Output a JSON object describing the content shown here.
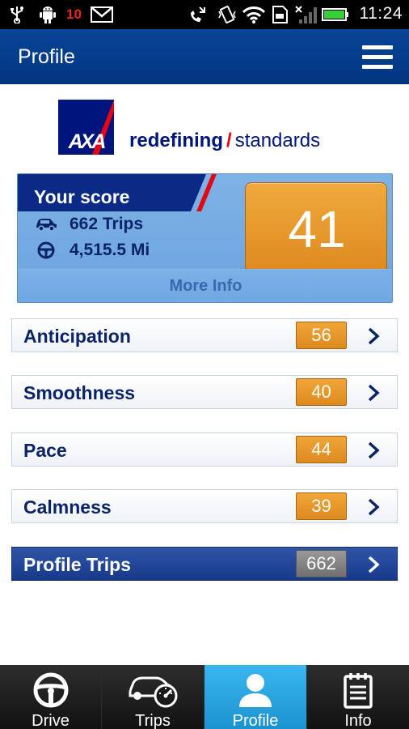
{
  "status_bar": {
    "notification_count": "10",
    "time": "11:24",
    "icons": [
      "usb-icon",
      "android-debug-icon",
      "gmail-icon",
      "missed-call-icon",
      "vibrate-icon",
      "wifi-icon",
      "sd-card-icon",
      "no-signal-icon",
      "battery-icon"
    ]
  },
  "header": {
    "title": "Profile",
    "menu_icon": "hamburger-menu-icon"
  },
  "brand": {
    "logo_text": "AXA",
    "slogan_bold": "redefining",
    "slogan_slash": "/",
    "slogan_rest": "standards",
    "colors": {
      "navy": "#00147d",
      "red": "#e30613"
    }
  },
  "score_card": {
    "title": "Your score",
    "trips": "662 Trips",
    "distance": "4,515.5 Mi",
    "score": "41",
    "more_info": "More Info",
    "icons": [
      "car-trips-icon",
      "steering-wheel-icon"
    ]
  },
  "categories": [
    {
      "label": "Anticipation",
      "value": "56"
    },
    {
      "label": "Smoothness",
      "value": "40"
    },
    {
      "label": "Pace",
      "value": "44"
    },
    {
      "label": "Calmness",
      "value": "39"
    }
  ],
  "profile_trips": {
    "label": "Profile Trips",
    "value": "662"
  },
  "bottom_nav": {
    "tabs": [
      {
        "label": "Drive",
        "icon": "steering-wheel-icon",
        "active": false
      },
      {
        "label": "Trips",
        "icon": "car-speedometer-icon",
        "active": false
      },
      {
        "label": "Profile",
        "icon": "person-icon",
        "active": true
      },
      {
        "label": "Info",
        "icon": "notepad-icon",
        "active": false
      }
    ],
    "active_color": "#26a6e2"
  }
}
